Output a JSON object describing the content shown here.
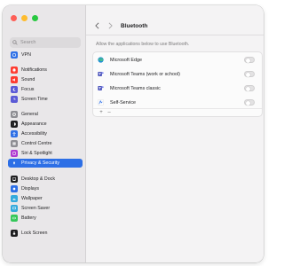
{
  "sidebar": {
    "search_placeholder": "Search",
    "items": [
      {
        "label": "VPN",
        "icon": "vpn-icon",
        "color": "#2d6fe6"
      },
      {
        "label": "Notifications",
        "icon": "notifications-icon",
        "color": "#fe3b30"
      },
      {
        "label": "Sound",
        "icon": "sound-icon",
        "color": "#fe3b30"
      },
      {
        "label": "Focus",
        "icon": "focus-icon",
        "color": "#5b5ad6"
      },
      {
        "label": "Screen Time",
        "icon": "screen-time-icon",
        "color": "#5b5ad6"
      },
      {
        "label": "General",
        "icon": "general-icon",
        "color": "#8e8e93"
      },
      {
        "label": "Appearance",
        "icon": "appearance-icon",
        "color": "#1d1d1f"
      },
      {
        "label": "Accessibility",
        "icon": "accessibility-icon",
        "color": "#2d6fe6"
      },
      {
        "label": "Control Centre",
        "icon": "control-centre-icon",
        "color": "#8e8e93"
      },
      {
        "label": "Siri & Spotlight",
        "icon": "siri-icon",
        "color": "#b03ad0"
      },
      {
        "label": "Privacy & Security",
        "icon": "privacy-icon",
        "color": "#2d6fe6",
        "selected": true
      },
      {
        "label": "Desktop & Dock",
        "icon": "desktop-dock-icon",
        "color": "#1d1d1f"
      },
      {
        "label": "Displays",
        "icon": "displays-icon",
        "color": "#2d6fe6"
      },
      {
        "label": "Wallpaper",
        "icon": "wallpaper-icon",
        "color": "#34aadc"
      },
      {
        "label": "Screen Saver",
        "icon": "screen-saver-icon",
        "color": "#34aadc"
      },
      {
        "label": "Battery",
        "icon": "battery-icon",
        "color": "#34c759"
      },
      {
        "label": "Lock Screen",
        "icon": "lock-screen-icon",
        "color": "#1d1d1f"
      }
    ]
  },
  "main": {
    "title": "Bluetooth",
    "description": "Allow the applications below to use Bluetooth.",
    "apps": [
      {
        "name": "Microsoft Edge",
        "icon": "edge-icon",
        "enabled": false
      },
      {
        "name": "Microsoft Teams (work or school)",
        "icon": "teams-icon",
        "enabled": false
      },
      {
        "name": "Microsoft Teams classic",
        "icon": "teams-classic-icon",
        "enabled": false
      },
      {
        "name": "Self-Service",
        "icon": "self-service-icon",
        "enabled": false
      }
    ],
    "footer": {
      "add": "+",
      "remove": "–"
    }
  }
}
